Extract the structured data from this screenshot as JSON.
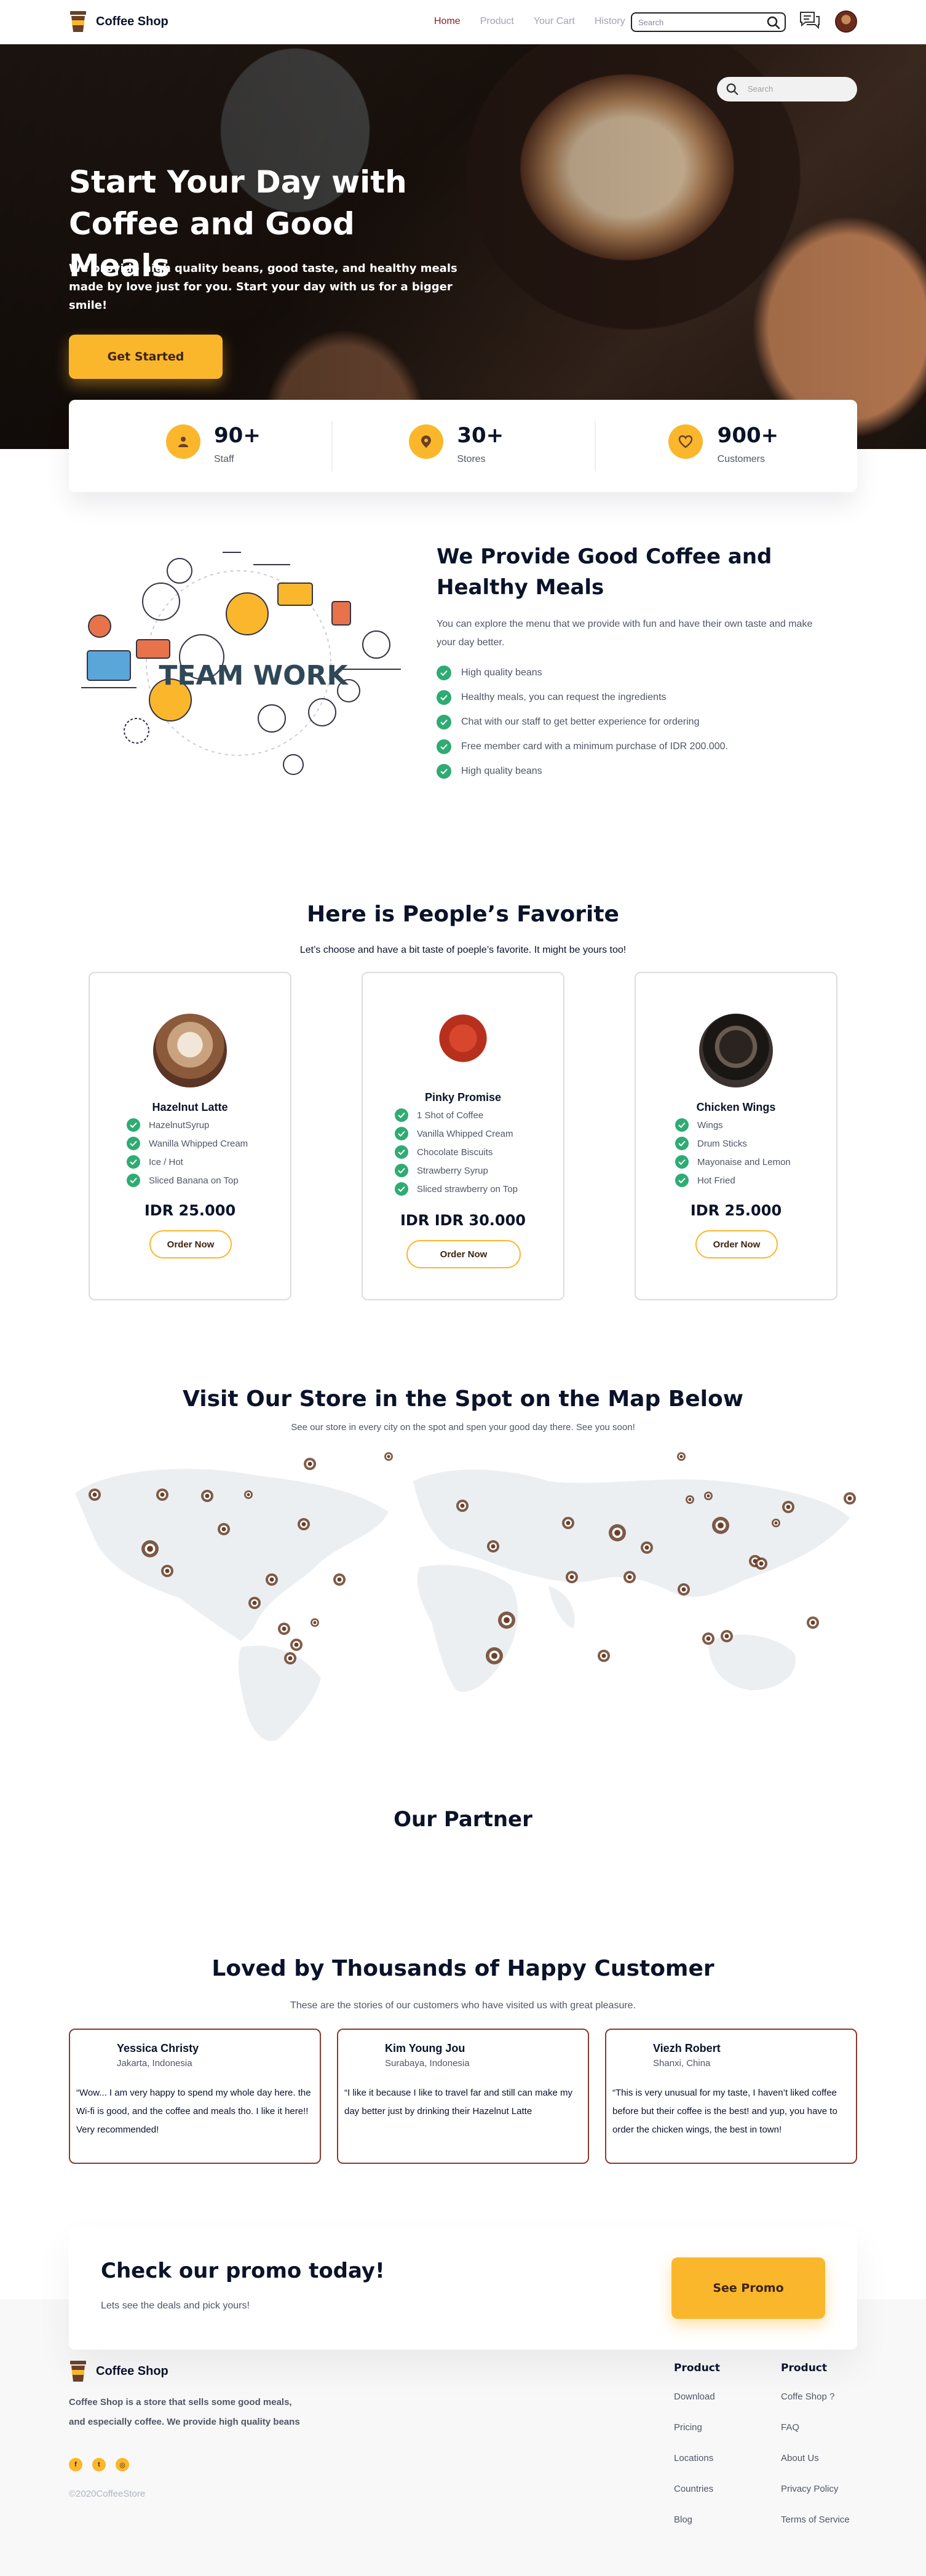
{
  "brand": {
    "name": "Coffee Shop"
  },
  "nav": {
    "items": [
      {
        "label": "Home",
        "active": true
      },
      {
        "label": "Product",
        "active": false
      },
      {
        "label": "Your Cart",
        "active": false
      },
      {
        "label": "History",
        "active": false
      }
    ],
    "search_placeholder": "Search"
  },
  "hero": {
    "title": "Start Your Day with Coffee and Good Meals",
    "subtitle": "We provide high quality beans, good taste, and healthy meals made by love just for you. Start your day with us for a bigger smile!",
    "cta": "Get Started",
    "search_placeholder": "Search"
  },
  "stats": [
    {
      "value": "90+",
      "label": "Staff",
      "icon": "user-icon"
    },
    {
      "value": "30+",
      "label": "Stores",
      "icon": "location-pin-icon"
    },
    {
      "value": "900+",
      "label": "Customers",
      "icon": "heart-icon"
    }
  ],
  "provide": {
    "illustration_text": "TEAM WORK",
    "title": "We Provide Good Coffee and Healthy Meals",
    "description": "You can explore the menu that we provide with fun and have their own taste and make your day better.",
    "features": [
      "High quality beans",
      "Healthy meals, you can request the ingredients",
      "Chat with our staff to get better experience for ordering",
      "Free member card with a minimum purchase of IDR 200.000.",
      "High quality beans"
    ]
  },
  "favorite": {
    "title": "Here is People’s Favorite",
    "subtitle": "Let’s choose and have a bit taste of poeple’s favorite. It might be yours too!",
    "products": [
      {
        "name": "Hazelnut Latte",
        "features": [
          "HazelnutSyrup",
          "Wanilla Whipped Cream",
          "Ice / Hot",
          "Sliced Banana on Top"
        ],
        "price": "IDR 25.000",
        "cta": "Order Now"
      },
      {
        "name": "Pinky Promise",
        "features": [
          "1 Shot of Coffee",
          "Vanilla Whipped Cream",
          "Chocolate Biscuits",
          "Strawberry Syrup",
          "Sliced strawberry on Top"
        ],
        "price": "IDR IDR 30.000",
        "cta": "Order Now"
      },
      {
        "name": "Chicken Wings",
        "features": [
          "Wings",
          "Drum Sticks",
          "Mayonaise and Lemon",
          "Hot Fried"
        ],
        "price": "IDR 25.000",
        "cta": "Order Now"
      }
    ]
  },
  "map": {
    "title": "Visit Our Store in the Spot on the Map Below",
    "subtitle": "See our store in every city on the spot and spen your good day there. See you soon!"
  },
  "partner": {
    "title": "Our Partner"
  },
  "testimonials": {
    "title": "Loved by Thousands of Happy Customer",
    "subtitle": "These are the stories of our customers who have visited us with great pleasure.",
    "items": [
      {
        "name": "Yessica Christy",
        "city": "Jakarta, Indonesia",
        "text": "“Wow... I am very happy to spend my whole day here. the Wi-fi is good, and the coffee and meals tho. I like it here!! Very recommended!"
      },
      {
        "name": "Kim Young Jou",
        "city": "Surabaya, Indonesia",
        "text": "“I like it because I like to travel far and still can make my day better just by drinking their Hazelnut Latte"
      },
      {
        "name": "Viezh Robert",
        "city": "Shanxi, China",
        "text": "“This is very unusual for my taste, I haven’t liked coffee before but their coffee is the best! and yup, you have to order the chicken wings, the best in town!"
      }
    ]
  },
  "promo": {
    "title": "Check our promo today!",
    "subtitle": "Lets see the deals and pick yours!",
    "cta": "See Promo"
  },
  "footer": {
    "brand": "Coffee Shop",
    "description": "Coffee Shop is a store that sells some good meals, and especially coffee. We provide high quality beans",
    "socials": [
      {
        "icon": "facebook-icon",
        "glyph": "f"
      },
      {
        "icon": "twitter-icon",
        "glyph": "t"
      },
      {
        "icon": "instagram-icon",
        "glyph": "◎"
      }
    ],
    "copyright": "©2020CoffeeStore",
    "columns": [
      {
        "title": "Product",
        "links": [
          "Download",
          "Pricing",
          "Locations",
          "Countries",
          "Blog"
        ]
      },
      {
        "title": "Product",
        "links": [
          "Coffe Shop ?",
          "FAQ",
          "About Us",
          "Privacy Policy",
          "Terms of Service"
        ]
      }
    ]
  },
  "colors": {
    "accent": "#fbb72c",
    "brand_dark": "#6a4029",
    "check": "#2fab73",
    "nav_active": "#8b1e1e"
  }
}
